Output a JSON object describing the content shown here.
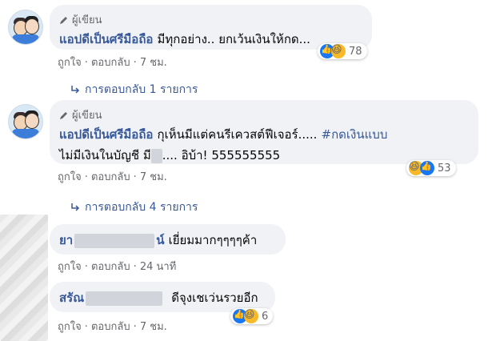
{
  "comments": [
    {
      "author_tag": "ผู้เขียน",
      "name": "แอปดีเป็นศรีมือถือ",
      "text": "มีทุกอย่าง.. ยกเว้นเงินให้กด...",
      "actions": {
        "like": "ถูกใจ",
        "reply": "ตอบกลับ",
        "time": "7 ชม."
      },
      "reactions": {
        "count": "78",
        "icons": [
          "like-icon",
          "haha-icon"
        ]
      },
      "replies": "การตอบกลับ 1 รายการ"
    },
    {
      "author_tag": "ผู้เขียน",
      "name": "แอปดีเป็นศรีมือถือ",
      "text_part1": "กุเห็นมีแต่คนรีเควสต์ฟีเจอร์.....",
      "hashtag": "#กดเงินแบบ",
      "line2_a": "ไม่มีเงินในบัญชี มี",
      "line2_b": ".... อิบ้า! 555555555",
      "actions": {
        "like": "ถูกใจ",
        "reply": "ตอบกลับ",
        "time": "7 ชม."
      },
      "reactions": {
        "count": "53",
        "icons": [
          "haha-icon",
          "like-icon"
        ]
      },
      "replies": "การตอบกลับ 4 รายการ"
    },
    {
      "name_a": "ยา",
      "name_b": "น์",
      "text": "เยี่ยมมากๆๆๆๆค้า",
      "actions": {
        "like": "ถูกใจ",
        "reply": "ตอบกลับ",
        "time": "24 นาที"
      }
    },
    {
      "name_a": "สรัณ",
      "text": "ดีจุงเชเว่นรวยอีก",
      "actions": {
        "like": "ถูกใจ",
        "reply": "ตอบกลับ",
        "time": "7 ชม."
      },
      "reactions": {
        "count": "6",
        "icons": [
          "like-icon",
          "haha-icon"
        ]
      }
    }
  ],
  "colors": {
    "link": "#385898",
    "bubble": "#f0f2f5",
    "meta": "#65676b"
  }
}
